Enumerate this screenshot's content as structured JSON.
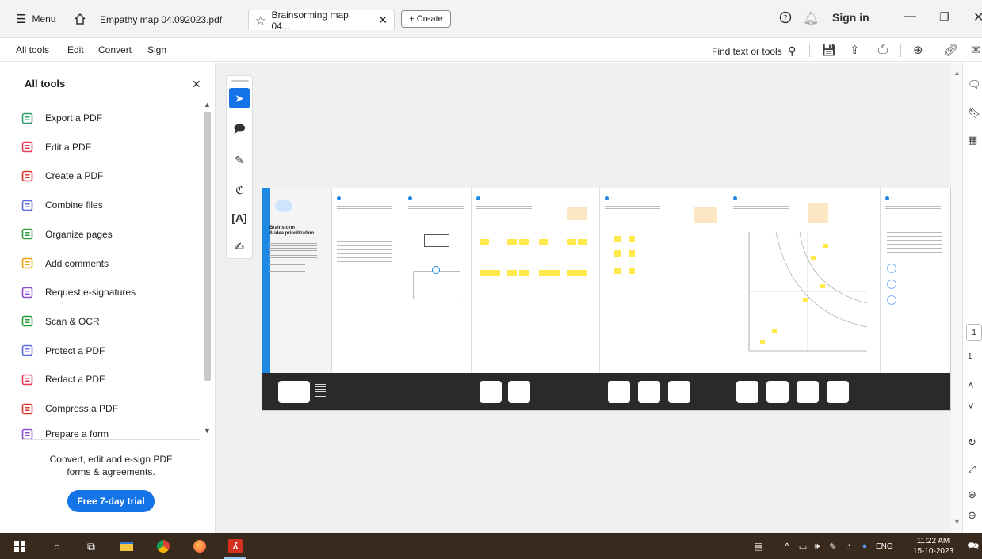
{
  "titlebar": {
    "menu_label": "Menu",
    "home_icon": "home-icon",
    "tab1_label": "Empathy map  04.092023.pdf",
    "tab2_label": "Brainsorming map  04...",
    "create_label": "+ Create",
    "help_icon": "help-icon",
    "bell_icon": "bell-icon",
    "sign_in": "Sign in"
  },
  "menubar": {
    "items": [
      "All tools",
      "Edit",
      "Convert",
      "Sign"
    ],
    "find_label": "Find text or tools"
  },
  "left_panel": {
    "title": "All tools",
    "tools": [
      {
        "label": "Export a PDF",
        "icon": "export-pdf-icon",
        "color": "#2f9e6b"
      },
      {
        "label": "Edit a PDF",
        "icon": "edit-pdf-icon",
        "color": "#e23a5b"
      },
      {
        "label": "Create a PDF",
        "icon": "create-pdf-icon",
        "color": "#e0362c"
      },
      {
        "label": "Combine files",
        "icon": "combine-files-icon",
        "color": "#5d6bd8"
      },
      {
        "label": "Organize pages",
        "icon": "organize-pages-icon",
        "color": "#2e9a3a"
      },
      {
        "label": "Add comments",
        "icon": "add-comments-icon",
        "color": "#e6a400"
      },
      {
        "label": "Request e-signatures",
        "icon": "request-esign-icon",
        "color": "#8a4fd0"
      },
      {
        "label": "Scan & OCR",
        "icon": "scan-ocr-icon",
        "color": "#2e9a3a"
      },
      {
        "label": "Protect a PDF",
        "icon": "protect-pdf-icon",
        "color": "#5d6bd8"
      },
      {
        "label": "Redact a PDF",
        "icon": "redact-pdf-icon",
        "color": "#e23a5b"
      },
      {
        "label": "Compress a PDF",
        "icon": "compress-pdf-icon",
        "color": "#e0362c"
      },
      {
        "label": "Prepare a form",
        "icon": "prepare-form-icon",
        "color": "#8a4fd0"
      }
    ],
    "promo_line1": "Convert, edit and e-sign PDF",
    "promo_line2": "forms & agreements.",
    "trial_button": "Free 7-day trial"
  },
  "board": {
    "intro_title_line1": "Brainstorm",
    "intro_title_line2": "& idea prioritization"
  },
  "taskbar": {
    "time": "11:22 AM",
    "date": "15-10-2023",
    "lang": "ENG"
  },
  "colors": {
    "accent": "#1473e6",
    "sticky": "#ffe94d",
    "taskbar": "#3a2a1e"
  }
}
